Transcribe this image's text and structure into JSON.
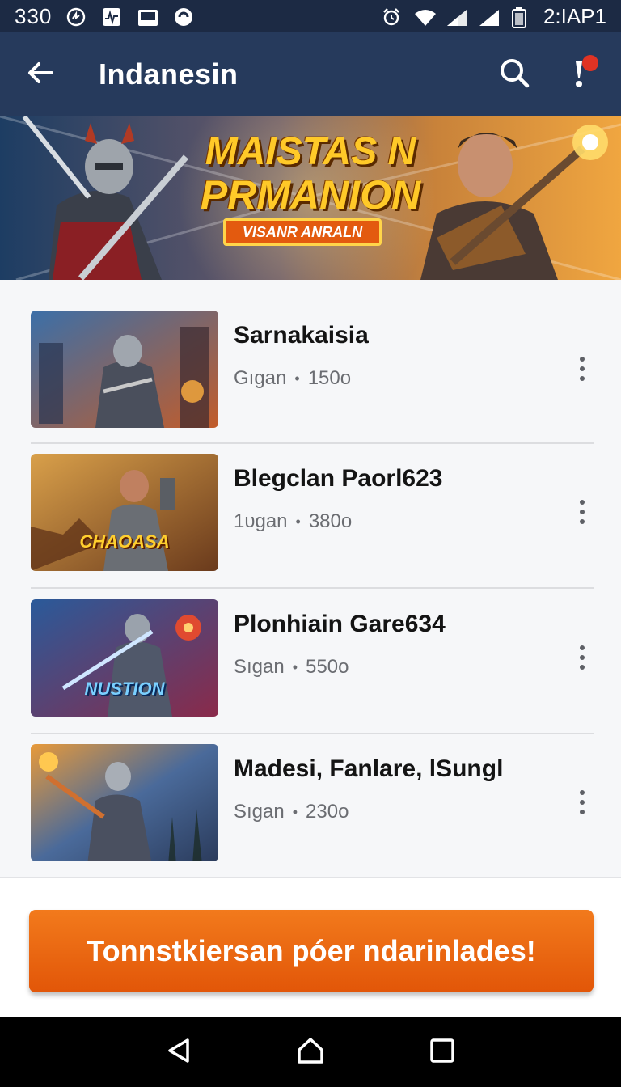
{
  "status_bar": {
    "time": "330",
    "carrier": "2:IAP1",
    "icons": [
      "sync-icon",
      "activity-icon",
      "screen-icon",
      "chat-icon",
      "alarm-icon",
      "wifi-icon",
      "signal-icon",
      "signal-icon",
      "battery-icon"
    ]
  },
  "app_bar": {
    "title": "Indanesin",
    "back_icon": "arrow-left-icon",
    "search_icon": "search-icon",
    "notification_icon": "notification-icon"
  },
  "banner": {
    "headline_line1": "MAISTAS N",
    "headline_line2": "PRMANION",
    "ribbon_text": "VISANR ANRALN"
  },
  "list": {
    "items": [
      {
        "title": "Sarnakaisia",
        "subtitle": "Gıgan",
        "count": "150o",
        "thumb_caption": ""
      },
      {
        "title": "Blegclan Paorl623",
        "subtitle": "1ᴜgan",
        "count": "380o",
        "thumb_caption": "CHAOASA"
      },
      {
        "title": "Plonhiain Gare634",
        "subtitle": "Sıgan",
        "count": "550o",
        "thumb_caption": "NUSTION"
      },
      {
        "title": "Madesi, Fanlare, lSungl",
        "subtitle": "Sıgan",
        "count": "230o",
        "thumb_caption": ""
      }
    ],
    "separator": "•"
  },
  "cta": {
    "label": "Tonnstkiersan póer ndarinlades!"
  },
  "nav": {
    "back_icon": "triangle-back-icon",
    "home_icon": "home-icon",
    "recents_icon": "square-recents-icon"
  },
  "colors": {
    "status_bar": "#1c2a44",
    "app_bar": "#263a5c",
    "cta": "#e8620e",
    "notification_dot": "#e03324"
  }
}
